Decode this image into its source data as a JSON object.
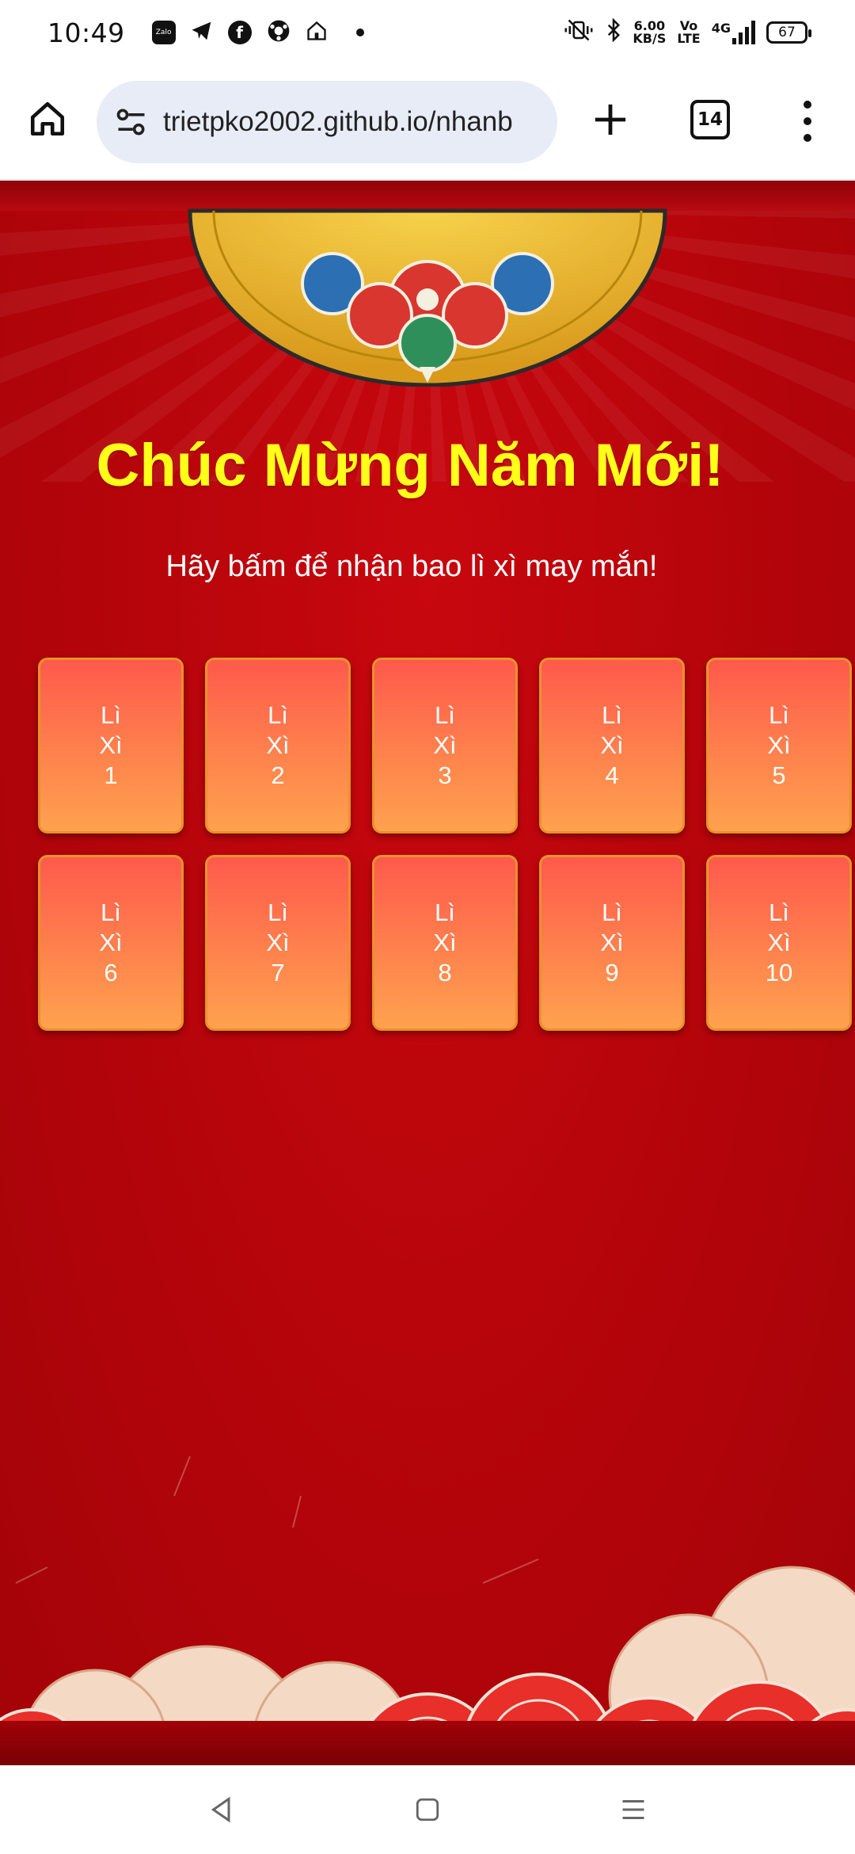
{
  "status_bar": {
    "time": "10:49",
    "left_icons": [
      "zalo-icon",
      "telegram-icon",
      "facebook-icon",
      "app-icon",
      "home-app-icon"
    ],
    "net_speed": "6.00\nKB/S",
    "volte": "Vo\nLTE",
    "network": "4G",
    "battery": "67"
  },
  "browser": {
    "url": "trietpko2002.github.io/nhanb",
    "tab_count": "14"
  },
  "page": {
    "greeting": "Chúc Mừng Năm Mới!",
    "subtitle": "Hãy bấm để nhận bao lì xì may mắn!",
    "envelopes": [
      {
        "label": "Lì\nXì\n1"
      },
      {
        "label": "Lì\nXì\n2"
      },
      {
        "label": "Lì\nXì\n3"
      },
      {
        "label": "Lì\nXì\n4"
      },
      {
        "label": "Lì\nXì\n5"
      },
      {
        "label": "Lì\nXì\n6"
      },
      {
        "label": "Lì\nXì\n7"
      },
      {
        "label": "Lì\nXì\n8"
      },
      {
        "label": "Lì\nXì\n9"
      },
      {
        "label": "Lì\nXì\n10"
      }
    ]
  },
  "nav_bar": [
    "back-icon",
    "home-square-icon",
    "recents-menu-icon"
  ],
  "colors": {
    "page_red": "#b7050b",
    "greeting_yellow": "#ffff1a",
    "envelope_top": "#ff5a4c",
    "envelope_bottom": "#ffa24e",
    "url_bar_bg": "#e8ecf6"
  }
}
